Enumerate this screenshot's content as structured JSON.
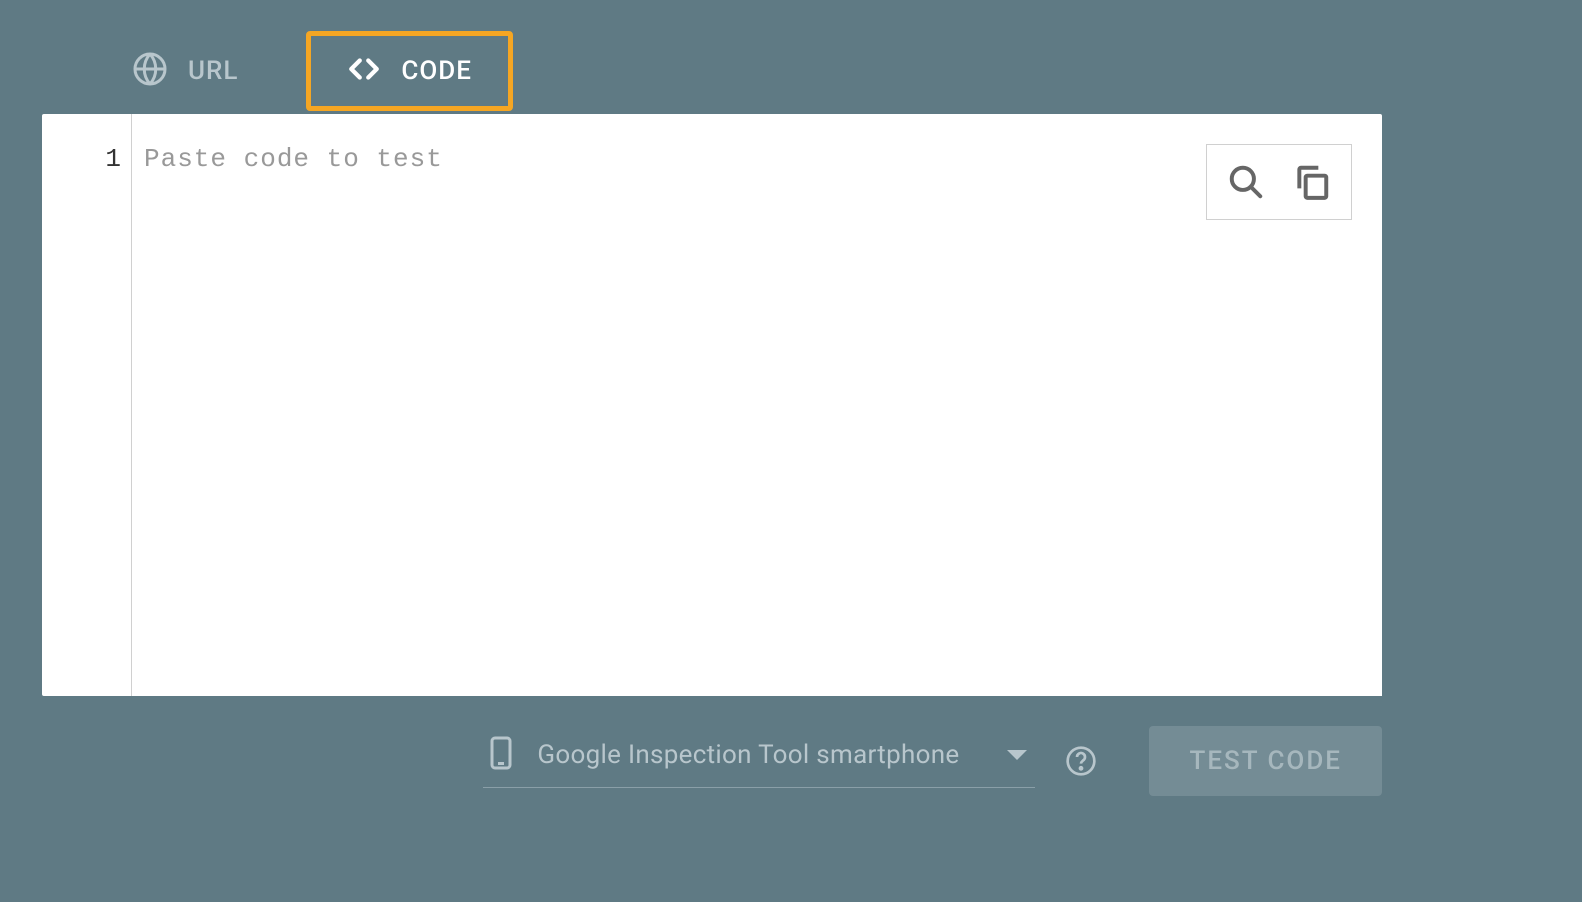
{
  "tabs": {
    "url": {
      "label": "URL"
    },
    "code": {
      "label": "CODE",
      "selected": true
    }
  },
  "editor": {
    "line_number": "1",
    "placeholder": "Paste code to test"
  },
  "footer": {
    "device_selected": "Google Inspection Tool smartphone",
    "test_button": "TEST CODE"
  }
}
